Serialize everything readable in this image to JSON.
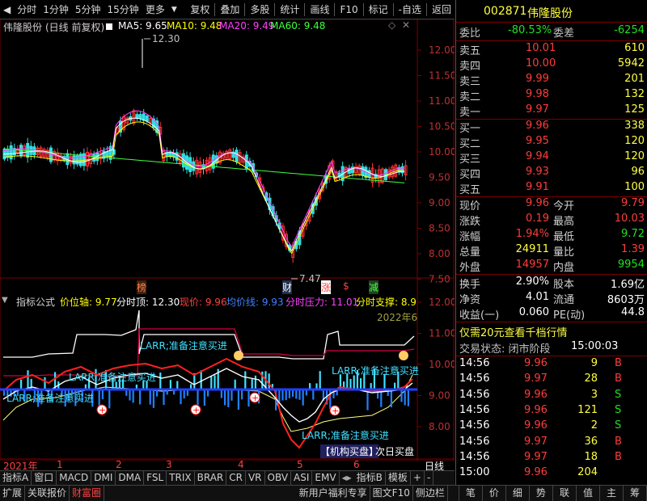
{
  "toolbar": {
    "left": [
      "分时",
      "1分钟",
      "5分钟",
      "15分钟",
      "更多"
    ],
    "right": [
      "复权",
      "叠加",
      "多股",
      "统计",
      "画线",
      "F10",
      "标记",
      "-自选",
      "返回"
    ]
  },
  "main_chart": {
    "title": "伟隆股份",
    "subtitle": "(日线 前复权)",
    "ma": [
      {
        "label": "MA5: 9.65",
        "color": "#ffffff"
      },
      {
        "label": "MA10: 9.48",
        "color": "#ffff00"
      },
      {
        "label": "MA20: 9.49",
        "color": "#ff40ff"
      },
      {
        "label": "MA60: 9.48",
        "color": "#40ff40"
      }
    ],
    "price_axis": [
      "12.00",
      "11.50",
      "11.00",
      "10.50",
      "10.00",
      "9.50",
      "9.00",
      "8.50",
      "8.00",
      "7.50"
    ],
    "high_label": "12.30",
    "low_label": "7.47",
    "markers": [
      {
        "text": "榜",
        "color": "#ff8040"
      },
      {
        "text": "财",
        "color": "#ffffff"
      },
      {
        "text": "涨",
        "color": "#ff4040"
      },
      {
        "text": "$",
        "color": "#ff4040"
      },
      {
        "text": "减",
        "color": "#40ff40"
      }
    ]
  },
  "indicator": {
    "name": "指标公式",
    "items": [
      {
        "label": "价位轴: 9.77",
        "color": "#ffff00"
      },
      {
        "label": "分时顶: 12.30",
        "color": "#ffffff"
      },
      {
        "label": "现价: 9.96",
        "color": "#ff4040"
      },
      {
        "label": "均价线: 9.93",
        "color": "#4080ff"
      },
      {
        "label": "分时压力: 11.01",
        "color": "#ff40ff"
      },
      {
        "label": "分时支撑: 8.9",
        "color": "#ffff00"
      }
    ],
    "year_label": "2022年6",
    "axis": [
      "12.00",
      "11.00",
      "10.00",
      "9.00",
      "8.00"
    ],
    "notes": [
      "LARR;准备注意买进",
      "LARR;准备注意买进",
      "LARR;准备注意买进",
      "LARR;准备注意买进",
      "LARR;准备注意买进"
    ],
    "bottom_note": "【机构买盘】",
    "bottom_note2": "次日买盘"
  },
  "time_axis": {
    "labels": [
      "2021年",
      "1",
      "2",
      "3",
      "4",
      "5",
      "6"
    ],
    "period": "日线"
  },
  "tabs_row1": [
    "指标A",
    "窗口",
    "MACD",
    "DMI",
    "DMA",
    "FSL",
    "TRIX",
    "BRAR",
    "CR",
    "VR",
    "OBV",
    "ASI",
    "EMV",
    "指标B",
    "模板",
    "+",
    "-"
  ],
  "tabs_row2": [
    "扩展",
    "关联报价",
    "财富圈",
    "新用户福利专享",
    "图文F10",
    "侧边栏",
    "笔",
    "价",
    "细",
    "势",
    "联",
    "值",
    "主",
    "筹"
  ],
  "quote": {
    "code": "002871",
    "name": "伟隆股份",
    "weibi_label": "委比",
    "weibi": "-80.53%",
    "weicha_label": "委差",
    "weicha": "-6254",
    "asks": [
      {
        "label": "卖五",
        "price": "10.01",
        "vol": "610"
      },
      {
        "label": "卖四",
        "price": "10.00",
        "vol": "5942"
      },
      {
        "label": "卖三",
        "price": "9.99",
        "vol": "201"
      },
      {
        "label": "卖二",
        "price": "9.98",
        "vol": "132"
      },
      {
        "label": "卖一",
        "price": "9.97",
        "vol": "125"
      }
    ],
    "bids": [
      {
        "label": "买一",
        "price": "9.96",
        "vol": "338"
      },
      {
        "label": "买二",
        "price": "9.95",
        "vol": "120"
      },
      {
        "label": "买三",
        "price": "9.94",
        "vol": "120"
      },
      {
        "label": "买四",
        "price": "9.93",
        "vol": "96"
      },
      {
        "label": "买五",
        "price": "9.91",
        "vol": "100"
      }
    ],
    "stats": [
      {
        "l1": "现价",
        "v1": "9.96",
        "c1": "#ff3c3c",
        "l2": "今开",
        "v2": "9.79",
        "c2": "#ff3c3c"
      },
      {
        "l1": "涨跌",
        "v1": "0.19",
        "c1": "#ff3c3c",
        "l2": "最高",
        "v2": "10.03",
        "c2": "#ff3c3c"
      },
      {
        "l1": "涨幅",
        "v1": "1.94%",
        "c1": "#ff3c3c",
        "l2": "最低",
        "v2": "9.72",
        "c2": "#20e020"
      },
      {
        "l1": "总量",
        "v1": "24911",
        "c1": "#ffff40",
        "l2": "量比",
        "v2": "1.39",
        "c2": "#ff3c3c"
      },
      {
        "l1": "外盘",
        "v1": "14957",
        "c1": "#ff3c3c",
        "l2": "内盘",
        "v2": "9954",
        "c2": "#20e020"
      }
    ],
    "stats2": [
      {
        "l1": "换手",
        "v1": "2.90%",
        "l2": "股本",
        "v2": "1.69亿"
      },
      {
        "l1": "净资",
        "v1": "4.01",
        "l2": "流通",
        "v2": "8603万"
      },
      {
        "l1": "收益(一)",
        "v1": "0.060",
        "l2": "PE(动)",
        "v2": "44.8"
      }
    ],
    "promo": "仅需20元查看千档行情",
    "status_label": "交易状态: 闭市阶段",
    "status_time": "15:00:03",
    "ticks": [
      {
        "time": "14:56",
        "price": "9.96",
        "vol": "9",
        "bs": "B"
      },
      {
        "time": "14:56",
        "price": "9.97",
        "vol": "28",
        "bs": "B"
      },
      {
        "time": "14:56",
        "price": "9.96",
        "vol": "3",
        "bs": "S"
      },
      {
        "time": "14:56",
        "price": "9.96",
        "vol": "121",
        "bs": "S"
      },
      {
        "time": "14:56",
        "price": "9.96",
        "vol": "2",
        "bs": "S"
      },
      {
        "time": "14:56",
        "price": "9.97",
        "vol": "36",
        "bs": "B"
      },
      {
        "time": "14:56",
        "price": "9.97",
        "vol": "18",
        "bs": "B"
      },
      {
        "time": "15:00",
        "price": "9.96",
        "vol": "204",
        "bs": ""
      }
    ]
  }
}
